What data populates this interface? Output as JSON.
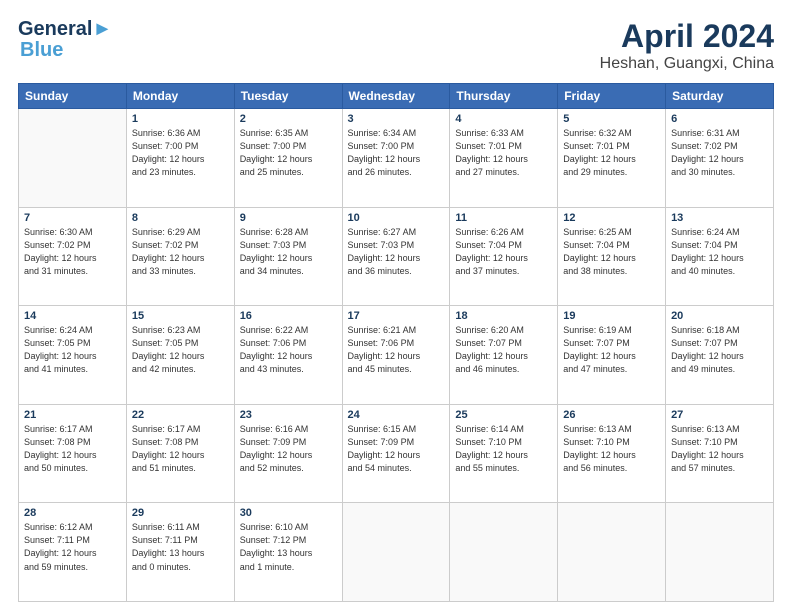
{
  "header": {
    "logo_line1": "General",
    "logo_line2": "Blue",
    "month": "April 2024",
    "location": "Heshan, Guangxi, China"
  },
  "weekdays": [
    "Sunday",
    "Monday",
    "Tuesday",
    "Wednesday",
    "Thursday",
    "Friday",
    "Saturday"
  ],
  "weeks": [
    [
      {
        "day": "",
        "info": ""
      },
      {
        "day": "1",
        "info": "Sunrise: 6:36 AM\nSunset: 7:00 PM\nDaylight: 12 hours\nand 23 minutes."
      },
      {
        "day": "2",
        "info": "Sunrise: 6:35 AM\nSunset: 7:00 PM\nDaylight: 12 hours\nand 25 minutes."
      },
      {
        "day": "3",
        "info": "Sunrise: 6:34 AM\nSunset: 7:00 PM\nDaylight: 12 hours\nand 26 minutes."
      },
      {
        "day": "4",
        "info": "Sunrise: 6:33 AM\nSunset: 7:01 PM\nDaylight: 12 hours\nand 27 minutes."
      },
      {
        "day": "5",
        "info": "Sunrise: 6:32 AM\nSunset: 7:01 PM\nDaylight: 12 hours\nand 29 minutes."
      },
      {
        "day": "6",
        "info": "Sunrise: 6:31 AM\nSunset: 7:02 PM\nDaylight: 12 hours\nand 30 minutes."
      }
    ],
    [
      {
        "day": "7",
        "info": "Sunrise: 6:30 AM\nSunset: 7:02 PM\nDaylight: 12 hours\nand 31 minutes."
      },
      {
        "day": "8",
        "info": "Sunrise: 6:29 AM\nSunset: 7:02 PM\nDaylight: 12 hours\nand 33 minutes."
      },
      {
        "day": "9",
        "info": "Sunrise: 6:28 AM\nSunset: 7:03 PM\nDaylight: 12 hours\nand 34 minutes."
      },
      {
        "day": "10",
        "info": "Sunrise: 6:27 AM\nSunset: 7:03 PM\nDaylight: 12 hours\nand 36 minutes."
      },
      {
        "day": "11",
        "info": "Sunrise: 6:26 AM\nSunset: 7:04 PM\nDaylight: 12 hours\nand 37 minutes."
      },
      {
        "day": "12",
        "info": "Sunrise: 6:25 AM\nSunset: 7:04 PM\nDaylight: 12 hours\nand 38 minutes."
      },
      {
        "day": "13",
        "info": "Sunrise: 6:24 AM\nSunset: 7:04 PM\nDaylight: 12 hours\nand 40 minutes."
      }
    ],
    [
      {
        "day": "14",
        "info": "Sunrise: 6:24 AM\nSunset: 7:05 PM\nDaylight: 12 hours\nand 41 minutes."
      },
      {
        "day": "15",
        "info": "Sunrise: 6:23 AM\nSunset: 7:05 PM\nDaylight: 12 hours\nand 42 minutes."
      },
      {
        "day": "16",
        "info": "Sunrise: 6:22 AM\nSunset: 7:06 PM\nDaylight: 12 hours\nand 43 minutes."
      },
      {
        "day": "17",
        "info": "Sunrise: 6:21 AM\nSunset: 7:06 PM\nDaylight: 12 hours\nand 45 minutes."
      },
      {
        "day": "18",
        "info": "Sunrise: 6:20 AM\nSunset: 7:07 PM\nDaylight: 12 hours\nand 46 minutes."
      },
      {
        "day": "19",
        "info": "Sunrise: 6:19 AM\nSunset: 7:07 PM\nDaylight: 12 hours\nand 47 minutes."
      },
      {
        "day": "20",
        "info": "Sunrise: 6:18 AM\nSunset: 7:07 PM\nDaylight: 12 hours\nand 49 minutes."
      }
    ],
    [
      {
        "day": "21",
        "info": "Sunrise: 6:17 AM\nSunset: 7:08 PM\nDaylight: 12 hours\nand 50 minutes."
      },
      {
        "day": "22",
        "info": "Sunrise: 6:17 AM\nSunset: 7:08 PM\nDaylight: 12 hours\nand 51 minutes."
      },
      {
        "day": "23",
        "info": "Sunrise: 6:16 AM\nSunset: 7:09 PM\nDaylight: 12 hours\nand 52 minutes."
      },
      {
        "day": "24",
        "info": "Sunrise: 6:15 AM\nSunset: 7:09 PM\nDaylight: 12 hours\nand 54 minutes."
      },
      {
        "day": "25",
        "info": "Sunrise: 6:14 AM\nSunset: 7:10 PM\nDaylight: 12 hours\nand 55 minutes."
      },
      {
        "day": "26",
        "info": "Sunrise: 6:13 AM\nSunset: 7:10 PM\nDaylight: 12 hours\nand 56 minutes."
      },
      {
        "day": "27",
        "info": "Sunrise: 6:13 AM\nSunset: 7:10 PM\nDaylight: 12 hours\nand 57 minutes."
      }
    ],
    [
      {
        "day": "28",
        "info": "Sunrise: 6:12 AM\nSunset: 7:11 PM\nDaylight: 12 hours\nand 59 minutes."
      },
      {
        "day": "29",
        "info": "Sunrise: 6:11 AM\nSunset: 7:11 PM\nDaylight: 13 hours\nand 0 minutes."
      },
      {
        "day": "30",
        "info": "Sunrise: 6:10 AM\nSunset: 7:12 PM\nDaylight: 13 hours\nand 1 minute."
      },
      {
        "day": "",
        "info": ""
      },
      {
        "day": "",
        "info": ""
      },
      {
        "day": "",
        "info": ""
      },
      {
        "day": "",
        "info": ""
      }
    ]
  ]
}
